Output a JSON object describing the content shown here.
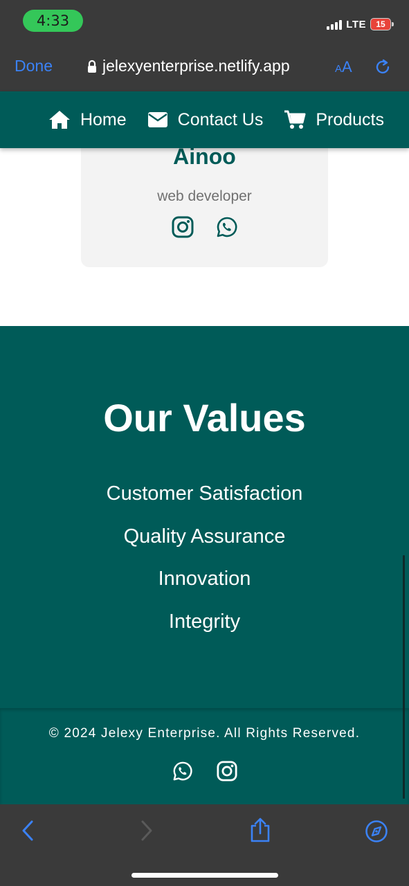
{
  "status_bar": {
    "time": "4:33",
    "network": "LTE",
    "battery": "15"
  },
  "browser": {
    "done_label": "Done",
    "url": "jelexyenterprise.netlify.app",
    "aa_small": "A",
    "aa_large": "A"
  },
  "nav": {
    "items": [
      {
        "label": "Home",
        "icon": "home-icon"
      },
      {
        "label": "Contact Us",
        "icon": "envelope-icon"
      },
      {
        "label": "Products",
        "icon": "cart-icon"
      }
    ]
  },
  "team_card": {
    "name": "Ainoo",
    "role": "web developer",
    "social_icons": [
      "instagram-icon",
      "whatsapp-icon"
    ]
  },
  "values": {
    "title": "Our Values",
    "items": [
      "Customer Satisfaction",
      "Quality Assurance",
      "Innovation",
      "Integrity"
    ]
  },
  "footer": {
    "copyright": "© 2024 Jelexy Enterprise. All Rights Reserved.",
    "social_icons": [
      "whatsapp-icon",
      "instagram-icon"
    ]
  },
  "colors": {
    "brand": "#005b58",
    "safari_blue": "#3b82f6",
    "chrome_bg": "#3a3a3a",
    "status_green": "#34c759"
  },
  "toolbar": {
    "icons": [
      "back-icon",
      "forward-icon",
      "share-icon",
      "compass-icon"
    ]
  }
}
